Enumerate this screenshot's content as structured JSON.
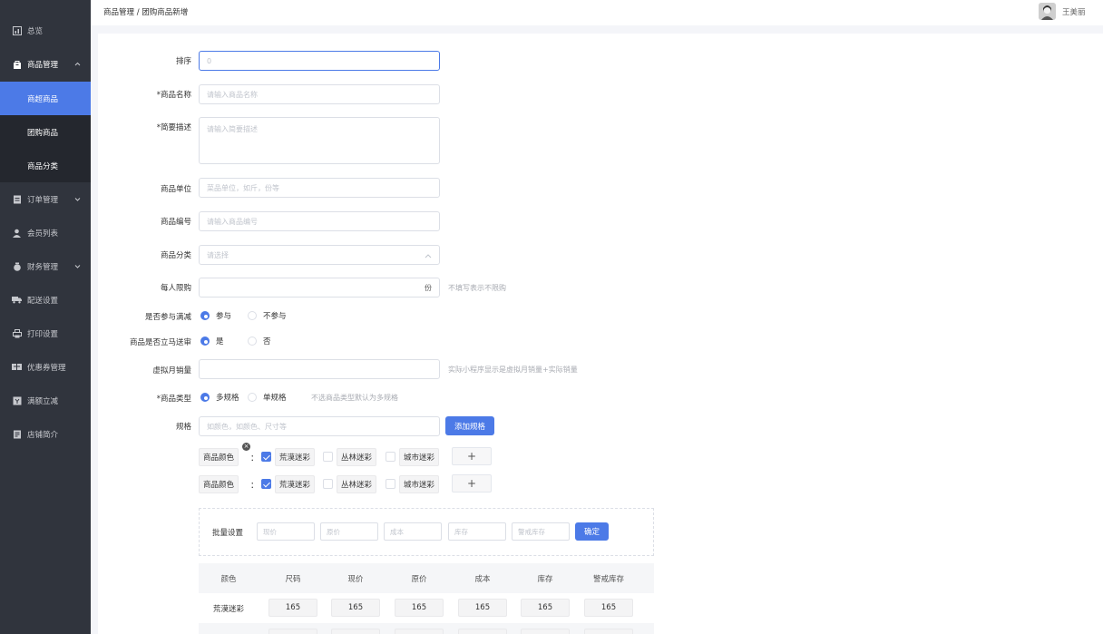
{
  "sidebar": {
    "items": [
      {
        "label": "总览",
        "icon": "dashboard-icon"
      },
      {
        "label": "商品管理",
        "icon": "bag-icon",
        "arrow": "^"
      },
      {
        "label": "商超商品"
      },
      {
        "label": "团购商品"
      },
      {
        "label": "商品分类"
      },
      {
        "label": "订单管理",
        "icon": "order-icon",
        "arrow": "v"
      },
      {
        "label": "会员列表",
        "icon": "member-icon"
      },
      {
        "label": "财务管理",
        "icon": "money-icon",
        "arrow": "v"
      },
      {
        "label": "配送设置",
        "icon": "truck-icon"
      },
      {
        "label": "打印设置",
        "icon": "printer-icon"
      },
      {
        "label": "优惠券管理",
        "icon": "coupon-icon"
      },
      {
        "label": "满额立减",
        "icon": "discount-icon"
      },
      {
        "label": "店铺简介",
        "icon": "store-icon"
      }
    ]
  },
  "header": {
    "breadcrumb": "商品管理 / 团购商品新增",
    "username": "王美丽"
  },
  "form": {
    "sort": {
      "label": "排序",
      "value": "0"
    },
    "name": {
      "label": "*商品名称",
      "placeholder": "请输入商品名称"
    },
    "desc": {
      "label": "*简要描述",
      "placeholder": "请输入简要描述"
    },
    "unit": {
      "label": "商品单位",
      "placeholder": "菜品单位，如斤，份等"
    },
    "code": {
      "label": "商品编号",
      "placeholder": "请输入商品编号"
    },
    "category": {
      "label": "商品分类",
      "placeholder": "请选择",
      "arrow": "^"
    },
    "limit": {
      "label": "每人限购",
      "suffix": "份",
      "hint": "不填写表示不限购"
    },
    "full_reduce": {
      "label": "是否参与满减",
      "options": [
        "参与",
        "不参与"
      ]
    },
    "instant": {
      "label": "商品是否立马送审",
      "options": [
        "是",
        "否"
      ]
    },
    "virtual_sales": {
      "label": "虚拟月销量",
      "hint": "实际小程序显示是虚拟月销量+实际销量"
    },
    "type": {
      "label": "*商品类型",
      "options": [
        "多规格",
        "单规格"
      ],
      "hint": "不选商品类型默认为多规格"
    },
    "spec": {
      "label": "规格",
      "placeholder": "如颜色，如颜色、尺寸等",
      "button": "添加规格"
    }
  },
  "specs": {
    "rows": [
      {
        "name": "商品颜色",
        "colon": "：",
        "values": [
          {
            "label": "荒漠迷彩",
            "checked": true
          },
          {
            "label": "丛林迷彩",
            "checked": false
          },
          {
            "label": "城市迷彩",
            "checked": false
          }
        ],
        "remove": "×"
      },
      {
        "name": "商品颜色",
        "colon": "：",
        "values": [
          {
            "label": "荒漠迷彩",
            "checked": true
          },
          {
            "label": "丛林迷彩",
            "checked": false
          },
          {
            "label": "城市迷彩",
            "checked": false
          }
        ]
      }
    ],
    "add": "+"
  },
  "batch": {
    "label": "批量设置",
    "fields": [
      "现价",
      "原价",
      "成本",
      "库存",
      "警戒库存"
    ],
    "confirm": "确定"
  },
  "table": {
    "headers": [
      "颜色",
      "尺码",
      "现价",
      "原价",
      "成本",
      "库存",
      "警戒库存"
    ],
    "rows": [
      {
        "color": "荒漠迷彩",
        "values": [
          "165",
          "165",
          "165",
          "165",
          "165",
          "165"
        ]
      }
    ]
  },
  "colors": {
    "accent": "#4c7ae7",
    "sidebar": "#30343d",
    "sidebar_sub": "#24272e"
  }
}
